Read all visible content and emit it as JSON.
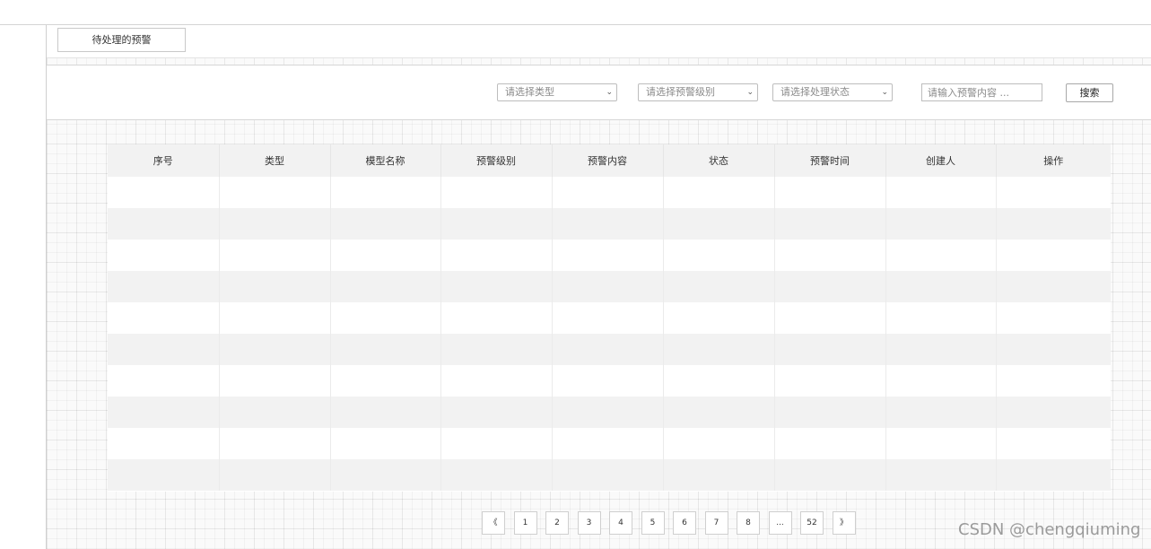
{
  "tabs": [
    {
      "label": "待处理的预警"
    }
  ],
  "filters": {
    "type_select": {
      "placeholder": "请选择类型"
    },
    "level_select": {
      "placeholder": "请选择预警级别"
    },
    "status_select": {
      "placeholder": "请选择处理状态"
    },
    "content_input": {
      "placeholder": "请输入预警内容 ..."
    },
    "search_label": "搜索"
  },
  "table": {
    "columns": [
      "序号",
      "类型",
      "模型名称",
      "预警级别",
      "预警内容",
      "状态",
      "预警时间",
      "创建人",
      "操作"
    ],
    "rows": []
  },
  "pagination": {
    "prev": "《",
    "pages": [
      "1",
      "2",
      "3",
      "4",
      "5",
      "6",
      "7",
      "8",
      "...",
      "52"
    ],
    "next": "》"
  },
  "watermark": "CSDN @chengqiuming",
  "icons": {
    "select_chevron": "chevron-down-icon"
  }
}
